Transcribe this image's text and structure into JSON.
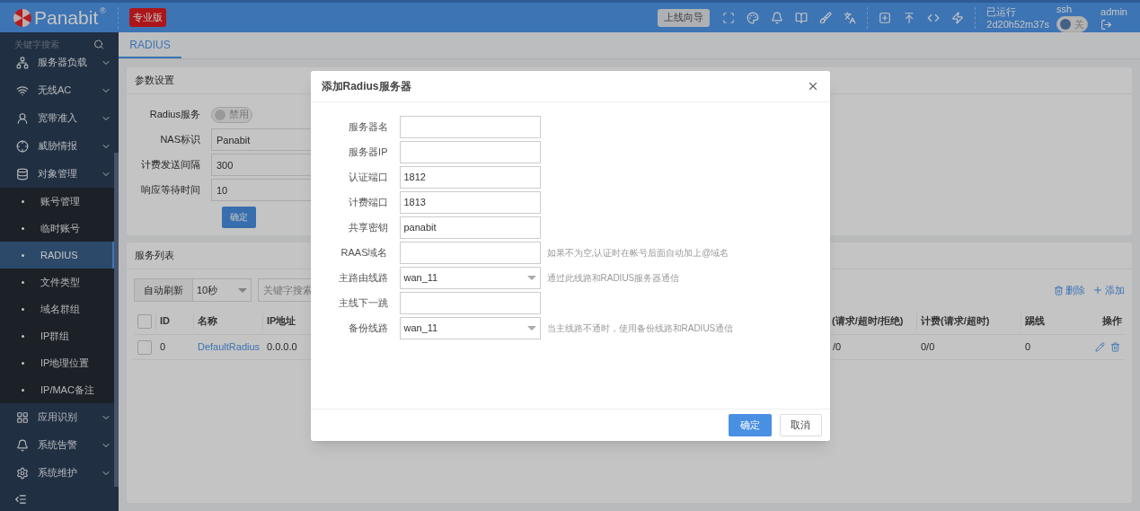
{
  "header": {
    "logo": "Panabit",
    "logo_mark": "®",
    "edition": "专业版",
    "guide_button": "上线向导",
    "uptime_label": "已运行",
    "uptime": "2d20h52m37s",
    "ssh_label": "ssh",
    "ssh_toggle": {
      "label": "关",
      "on": false
    },
    "user": "admin"
  },
  "sidebar": {
    "search_placeholder": "关键字搜索",
    "items": [
      {
        "label": "服务器负载"
      },
      {
        "label": "无线AC"
      },
      {
        "label": "宽带准入"
      },
      {
        "label": "威胁情报"
      },
      {
        "label": "对象管理",
        "children": [
          {
            "label": "账号管理",
            "selected": false
          },
          {
            "label": "临时账号",
            "selected": false
          },
          {
            "label": "RADIUS",
            "selected": true
          },
          {
            "label": "文件类型",
            "selected": false
          },
          {
            "label": "域名群组",
            "selected": false
          },
          {
            "label": "IP群组",
            "selected": false
          },
          {
            "label": "IP地理位置",
            "selected": false
          },
          {
            "label": "IP/MAC备注",
            "selected": false
          }
        ]
      },
      {
        "label": "应用识别"
      },
      {
        "label": "系统告警"
      },
      {
        "label": "系统维护"
      }
    ]
  },
  "tabs": [
    {
      "label": "RADIUS",
      "selected": true
    }
  ],
  "params_card": {
    "title": "参数设置",
    "radius_service": {
      "label": "Radius服务",
      "toggle_label": "禁用",
      "on": false
    },
    "fields": [
      {
        "label": "NAS标识",
        "value": "Panabit"
      },
      {
        "label": "计费发送间隔",
        "value": "300"
      },
      {
        "label": "响应等待时间",
        "value": "10"
      }
    ],
    "submit": "确定"
  },
  "service_card": {
    "title": "服务列表",
    "auto_refresh": "自动刷新",
    "interval": "10秒",
    "search_placeholder": "关键字搜索",
    "delete": "删除",
    "add": "添加",
    "header_checked": false,
    "columns": [
      "ID",
      "名称",
      "IP地址",
      "(请求/超时/拒绝)",
      "计费(请求/超时)",
      "踢线",
      "操作"
    ],
    "rows": [
      {
        "checked": false,
        "cells": [
          "0",
          "DefaultRadius",
          "0.0.0.0",
          "/0",
          "0/0",
          "0"
        ]
      }
    ]
  },
  "dialog": {
    "title": "添加Radius服务器",
    "fields": [
      {
        "kind": "text",
        "label": "服务器名"
      },
      {
        "kind": "text",
        "label": "服务器IP"
      },
      {
        "kind": "text",
        "label": "认证端口",
        "value": "1812"
      },
      {
        "kind": "text",
        "label": "计费端口",
        "value": "1813"
      },
      {
        "kind": "text",
        "label": "共享密钥",
        "value": "panabit"
      },
      {
        "kind": "text",
        "label": "RAAS域名",
        "hint": "如果不为空,认证时在帐号后面自动加上@域名"
      },
      {
        "kind": "select",
        "label": "主路由线路",
        "value": "wan_11",
        "hint": "通过此线路和RADIUS服务器通信"
      },
      {
        "kind": "text",
        "label": "主线下一跳"
      },
      {
        "kind": "select",
        "label": "备份线路",
        "value": "wan_11",
        "hint": "当主线路不通时，使用备份线路和RADIUS通信"
      }
    ],
    "ok": "确定",
    "cancel": "取消"
  }
}
